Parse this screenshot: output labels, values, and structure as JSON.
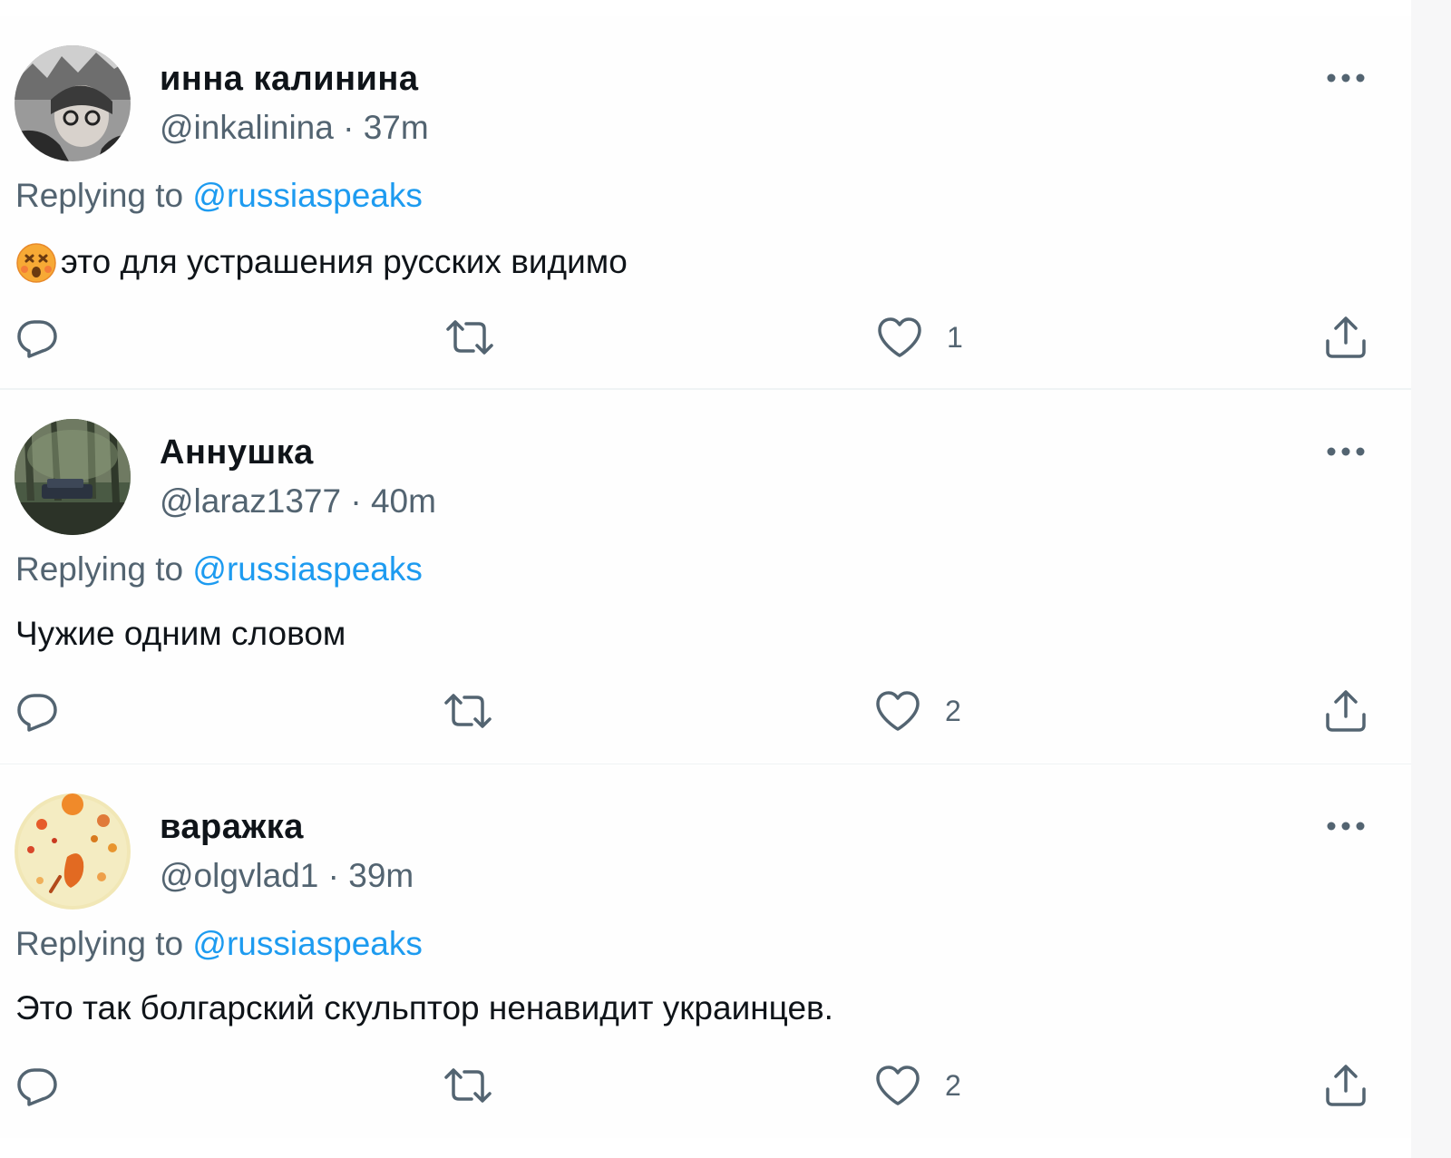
{
  "tweets": [
    {
      "display_name": "инна калинина",
      "handle": "@inkalinina",
      "separator": " · ",
      "time": "37m",
      "replying_prefix": "Replying to ",
      "replying_to": "@russiaspeaks",
      "emoji": "😵",
      "text": "это для устрашения русских видимо",
      "like_count": "1",
      "reply_count": "",
      "retweet_count": ""
    },
    {
      "display_name": "Аннушка",
      "handle": "@laraz1377",
      "separator": " · ",
      "time": "40m",
      "replying_prefix": "Replying to ",
      "replying_to": "@russiaspeaks",
      "text": "Чужие одним словом",
      "like_count": "2",
      "reply_count": "",
      "retweet_count": ""
    },
    {
      "display_name": "варажка",
      "handle": "@olgvlad1",
      "separator": " · ",
      "time": "39m",
      "replying_prefix": "Replying to ",
      "replying_to": "@russiaspeaks",
      "text": "Это так болгарский скульптор ненавидит украинцев.",
      "like_count": "2",
      "reply_count": "",
      "retweet_count": ""
    }
  ],
  "icons": {
    "more": "more-icon",
    "reply": "reply-icon",
    "retweet": "retweet-icon",
    "like": "heart-icon",
    "share": "share-icon"
  },
  "colors": {
    "text_primary": "#0f1419",
    "text_secondary": "#536471",
    "link": "#1d9bf0",
    "separator": "#eff3f4"
  }
}
